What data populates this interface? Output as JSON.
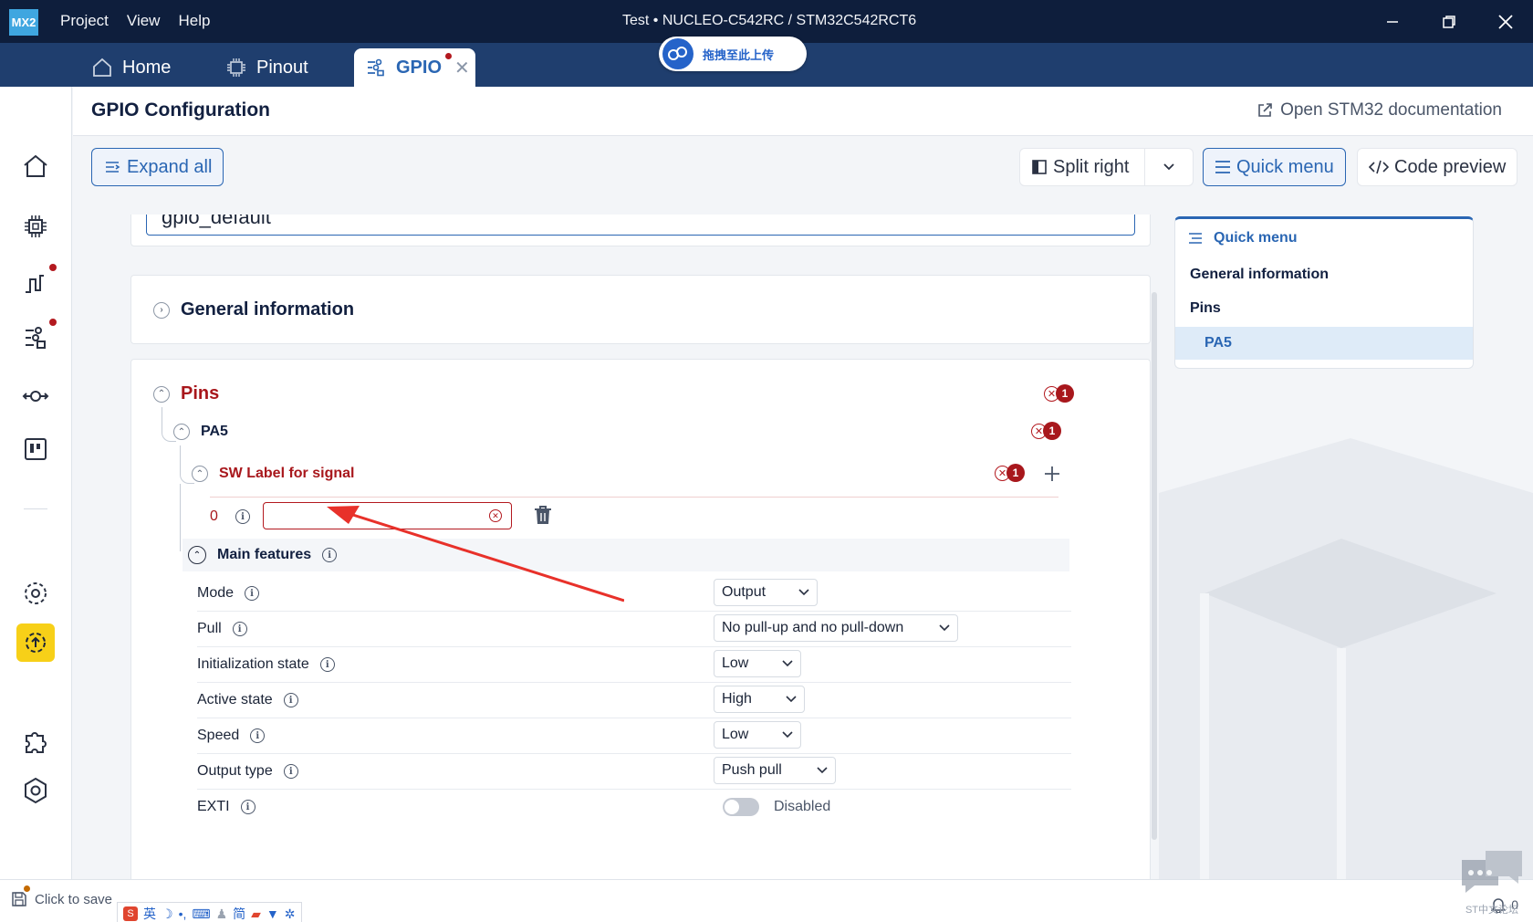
{
  "app": {
    "logo": "MX2",
    "menu": [
      "Project",
      "View",
      "Help"
    ],
    "window_title": "Test  •  NUCLEO-C542RC / STM32C542RCT6"
  },
  "tabs": [
    {
      "label": "Home",
      "icon": "home-icon"
    },
    {
      "label": "Pinout",
      "icon": "chip-icon"
    },
    {
      "label": "GPIO",
      "icon": "gpio-icon",
      "active": true,
      "modified": true
    }
  ],
  "upload_overlay": {
    "label": "拖拽至此上传",
    "icon": "cloud-icon"
  },
  "header": {
    "title": "GPIO Configuration",
    "doc_link": "Open STM32 documentation"
  },
  "toolbar": {
    "expand_all": "Expand all",
    "split_right": "Split right",
    "quick_menu": "Quick menu",
    "code_preview": "Code preview"
  },
  "config": {
    "instance_value": "gpio_default",
    "general_title": "General information",
    "pins_title": "Pins",
    "pins_errors": "1",
    "pin_name": "PA5",
    "pin_errors": "1",
    "sw_label_title": "SW Label for signal",
    "sw_label_errors": "1",
    "sw_label_index": "0",
    "sw_label_value": "",
    "main_features": "Main features",
    "properties": [
      {
        "label": "Mode",
        "value": "Output"
      },
      {
        "label": "Pull",
        "value": "No pull-up and no pull-down"
      },
      {
        "label": "Initialization state",
        "value": "Low"
      },
      {
        "label": "Active state",
        "value": "High"
      },
      {
        "label": "Speed",
        "value": "Low"
      },
      {
        "label": "Output type",
        "value": "Push pull"
      }
    ],
    "exti_label": "EXTI",
    "exti_state": "Disabled"
  },
  "quick_menu": {
    "title": "Quick menu",
    "items": [
      "General information",
      "Pins",
      "PA5"
    ]
  },
  "status": {
    "save": "Click to save",
    "notifications": "0",
    "ime_lang": "英",
    "ime_mode": "简",
    "watermark": "ST中文论坛"
  },
  "colors": {
    "titlebar": "#0e1e3c",
    "tabbar": "#1f3e6e",
    "accent": "#2a66b3",
    "error": "#a8171c",
    "active_rail": "#f7d018"
  }
}
